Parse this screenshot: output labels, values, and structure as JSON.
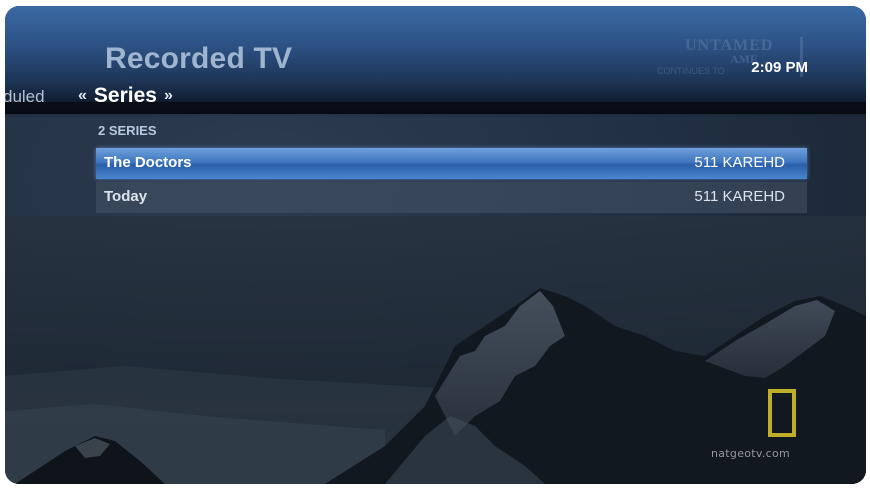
{
  "header": {
    "title": "Recorded TV",
    "clock": "2:09 PM"
  },
  "promo": {
    "line1": "UNTAMED",
    "line2": "AME",
    "line3": "CONTINUES TO"
  },
  "pivot": {
    "previous": "duled",
    "current": "Series",
    "left_arrow": "«",
    "right_arrow": "»"
  },
  "series": {
    "count_label": "2 SERIES",
    "items": [
      {
        "name": "The Doctors",
        "channel": "511 KAREHD"
      },
      {
        "name": "Today",
        "channel": "511 KAREHD"
      }
    ]
  },
  "watermark": {
    "text": "natgeotv.com",
    "logo_color": "#bfae28"
  },
  "colors": {
    "selection": "#3f76bf",
    "header": "#2d5386"
  }
}
